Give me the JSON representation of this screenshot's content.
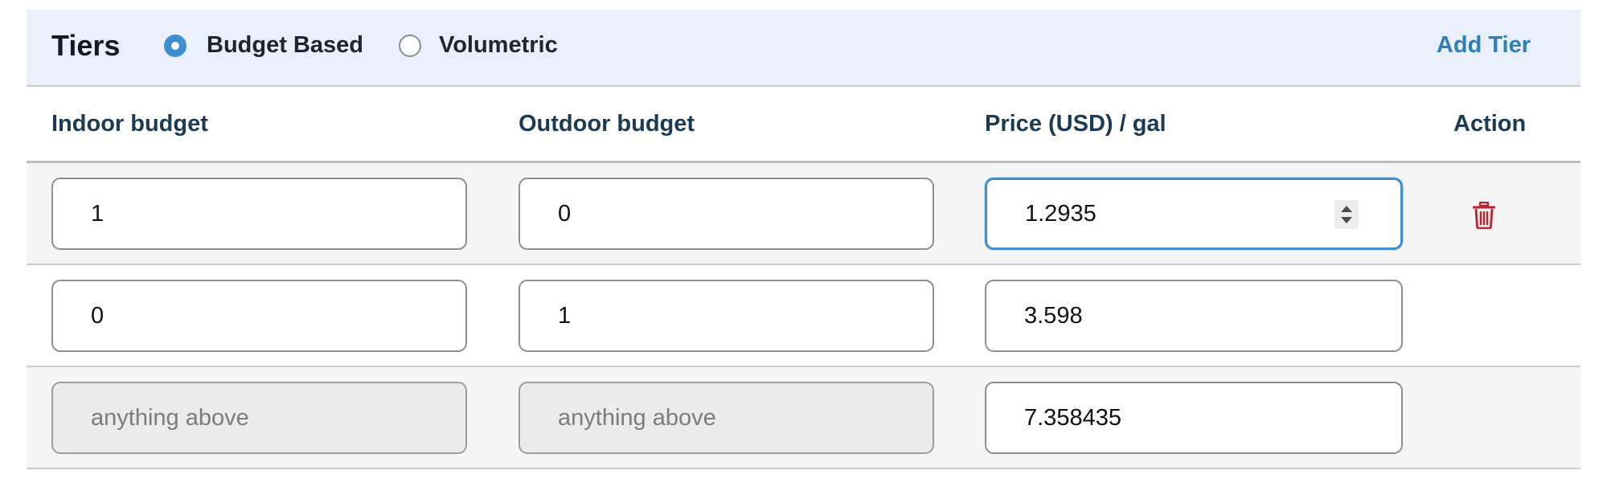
{
  "header": {
    "title": "Tiers",
    "radio_options": [
      {
        "label": "Budget Based",
        "selected": true
      },
      {
        "label": "Volumetric",
        "selected": false
      }
    ],
    "add_tier_label": "Add Tier"
  },
  "columns": [
    "Indoor budget",
    "Outdoor budget",
    "Price (USD) / gal",
    "Action"
  ],
  "rows": [
    {
      "indoor": "1",
      "outdoor": "0",
      "price": "1.2935",
      "action_icon": "trash-icon"
    },
    {
      "indoor": "0",
      "outdoor": "1",
      "price": "3.598"
    },
    {
      "indoor_placeholder": "anything above",
      "outdoor_placeholder": "anything above",
      "price": "7.358435"
    }
  ],
  "colors": {
    "accent": "#3d8fd0",
    "link": "#2e7fb6",
    "header_bg": "#eaf0fb",
    "column_header_text": "#1c3a52",
    "delete": "#b8232f"
  }
}
